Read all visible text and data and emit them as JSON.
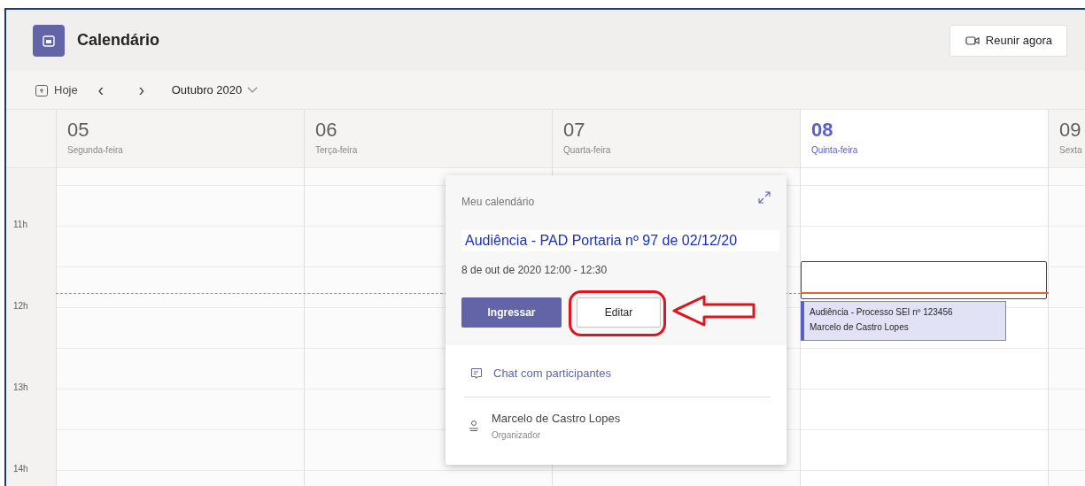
{
  "app": {
    "title": "Calendário",
    "meet_now_button": "Reunir agora"
  },
  "toolbar": {
    "today_button": "Hoje",
    "prev_icon": "‹",
    "next_icon": "›",
    "month": "Outubro 2020"
  },
  "days": [
    {
      "number": "05",
      "weekday": "Segunda-feira",
      "selected": false
    },
    {
      "number": "06",
      "weekday": "Terça-feira",
      "selected": false
    },
    {
      "number": "07",
      "weekday": "Quarta-feira",
      "selected": false
    },
    {
      "number": "08",
      "weekday": "Quinta-feira",
      "selected": true
    },
    {
      "number": "09",
      "weekday": "Sexta",
      "selected": false
    }
  ],
  "hours": [
    "11h",
    "12h",
    "13h",
    "14h"
  ],
  "event": {
    "title": "Audiência - Processo SEI nº 123456",
    "organizer": "Marcelo de Castro Lopes"
  },
  "popup": {
    "calendar": "Meu calendário",
    "title": "Audiência - PAD Portaria nº 97 de 02/12/20",
    "datetime": "8 de out de 2020 12:00 - 12:30",
    "join_button": "Ingressar",
    "edit_button": "Editar",
    "chat_link": "Chat com participantes",
    "organizer_name": "Marcelo de Castro Lopes",
    "organizer_role": "Organizador"
  }
}
